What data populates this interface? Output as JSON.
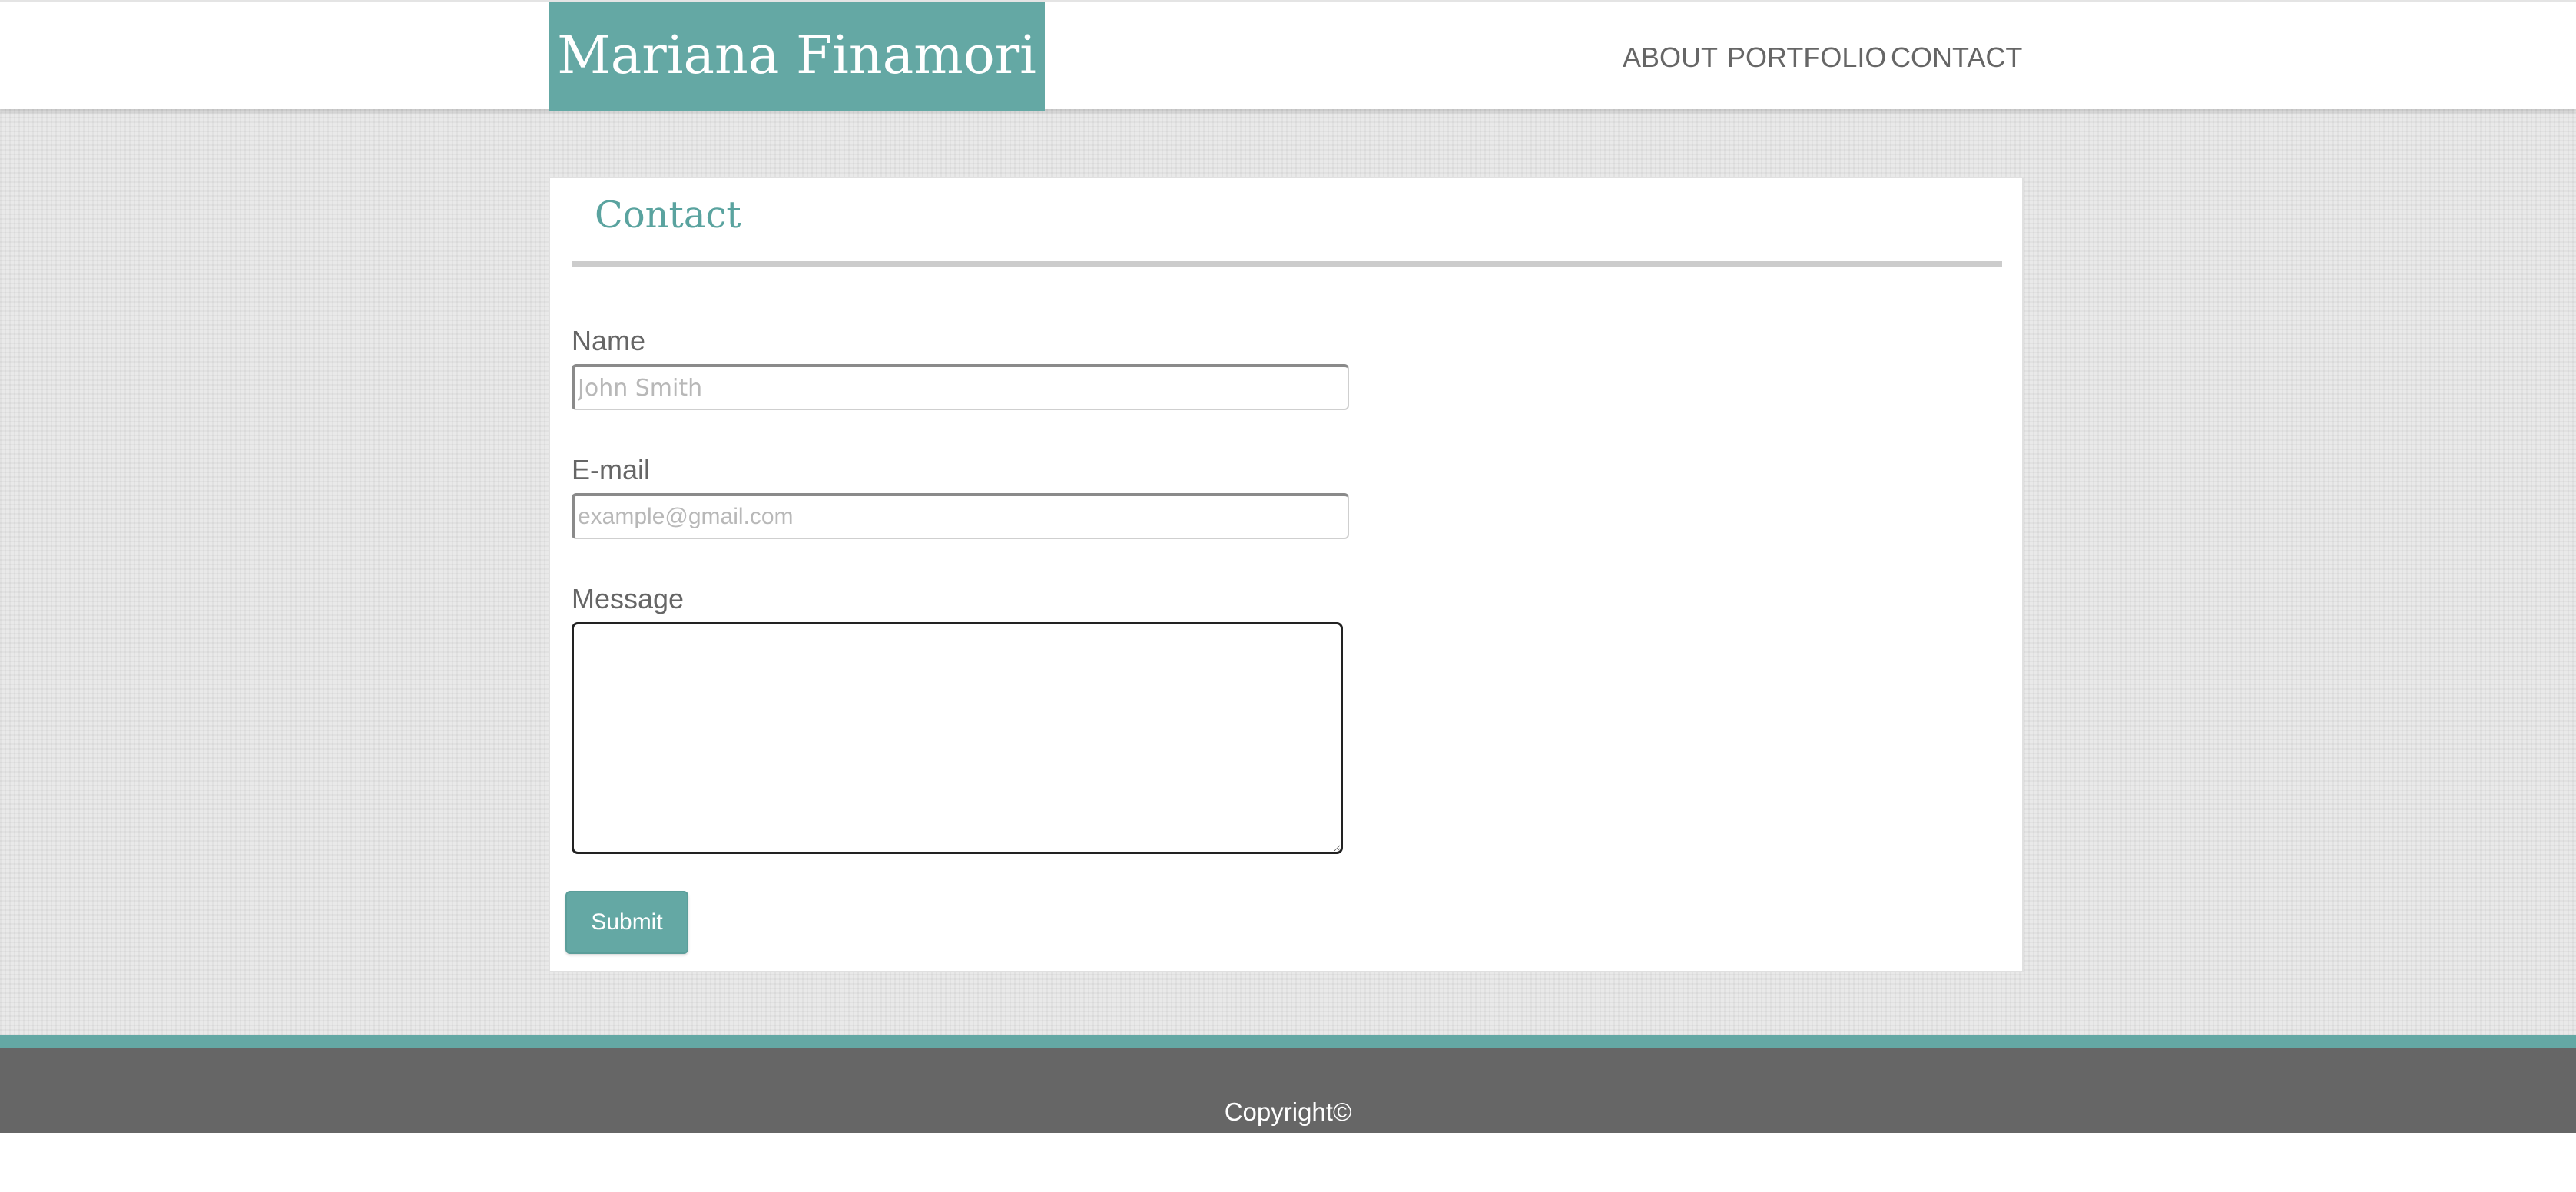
{
  "header": {
    "brand": "Mariana Finamori",
    "nav": {
      "about": "ABOUT",
      "portfolio": "PORTFOLIO",
      "contact": "CONTACT"
    }
  },
  "contact": {
    "title": "Contact",
    "name_label": "Name",
    "name_placeholder": "John Smith",
    "email_label": "E-mail",
    "email_placeholder": "example@gmail.com",
    "message_label": "Message",
    "submit_label": "Submit"
  },
  "footer": {
    "copyright": "Copyright©"
  },
  "colors": {
    "accent": "#64a8a4",
    "title_accent": "#5aa39f",
    "nav_text": "#666666",
    "footer_bg": "#666666",
    "page_bg": "#e9e9e9"
  }
}
